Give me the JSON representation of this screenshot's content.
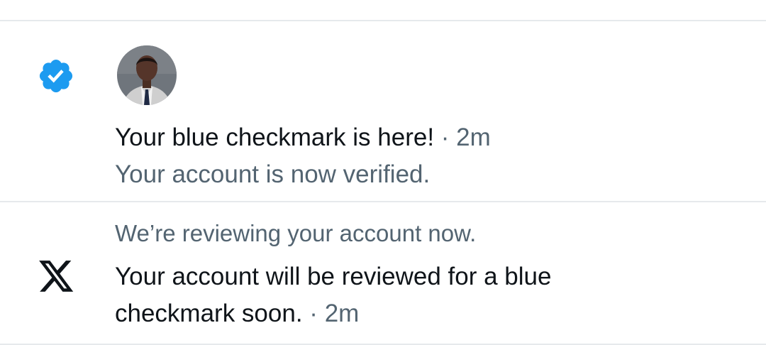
{
  "notifications": [
    {
      "type": "verified",
      "icon": "verified-badge-icon",
      "avatar": "user-avatar",
      "title": "Your blue checkmark is here!",
      "separator": "·",
      "time": "2m",
      "body": "Your account is now verified."
    },
    {
      "type": "system",
      "icon": "x-logo-icon",
      "heading": "We’re reviewing your account now.",
      "body_line1": "Your account will be reviewed for a blue",
      "body_line2": "checkmark soon.",
      "separator": "·",
      "time": "2m"
    }
  ],
  "colors": {
    "text_primary": "#0f1419",
    "text_secondary": "#536471",
    "verified_blue": "#1d9bf0",
    "divider": "#e6e9ec"
  }
}
